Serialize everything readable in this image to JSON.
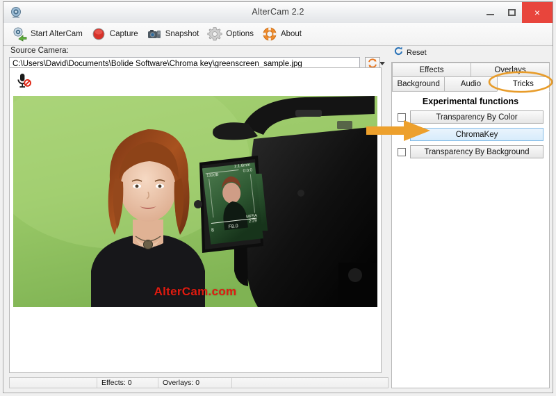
{
  "window": {
    "title": "AlterCam 2.2",
    "app_icon": "webcam-icon",
    "buttons": {
      "minimize": "minimize-icon",
      "maximize": "maximize-icon",
      "close": "×"
    }
  },
  "toolbar": {
    "items": [
      {
        "label": "Start AlterCam",
        "icon": "start-altercam-icon"
      },
      {
        "label": "Capture",
        "icon": "record-icon"
      },
      {
        "label": "Snapshot",
        "icon": "camera-icon"
      },
      {
        "label": "Options",
        "icon": "gear-icon"
      },
      {
        "label": "About",
        "icon": "lifebuoy-icon"
      }
    ]
  },
  "source": {
    "label": "Source Camera:",
    "value": "C:\\Users\\David\\Documents\\Bolide Software\\Chroma key\\greenscreen_sample.jpg",
    "refresh_icon": "refresh-icon",
    "dropdown_icon": "chevron-down-icon"
  },
  "preview": {
    "mic_icon": "microphone-muted-icon",
    "watermark": "AlterCam.com",
    "greenscreen_color": "#9cc96a",
    "camera_lcd": {
      "focal": "1:1.6 mm",
      "left_readout": "132dB",
      "right_readout": "0:0:0",
      "aperture": "F8.0",
      "mode": "MF 5A",
      "ratio": "2:29"
    }
  },
  "statusbar": {
    "cells": [
      "",
      "Effects: 0",
      "Overlays: 0",
      ""
    ]
  },
  "sidebar": {
    "reset": {
      "label": "Reset",
      "icon": "reset-icon"
    },
    "tabs_row1": [
      {
        "label": "Effects",
        "selected": false
      },
      {
        "label": "Overlays",
        "selected": false
      }
    ],
    "tabs_row2": [
      {
        "label": "Background",
        "selected": false
      },
      {
        "label": "Audio",
        "selected": false
      },
      {
        "label": "Tricks",
        "selected": true
      }
    ],
    "tricks": {
      "heading": "Experimental functions",
      "functions": [
        {
          "label": "Transparency By Color",
          "checkbox": true,
          "highlighted": false
        },
        {
          "label": "ChromaKey",
          "checkbox": false,
          "highlighted": true
        },
        {
          "label": "Transparency By Background",
          "checkbox": true,
          "highlighted": false
        }
      ]
    }
  },
  "annotations": {
    "color": "#e89c2a",
    "ellipse_target": "Tricks",
    "arrow_target": "ChromaKey"
  }
}
